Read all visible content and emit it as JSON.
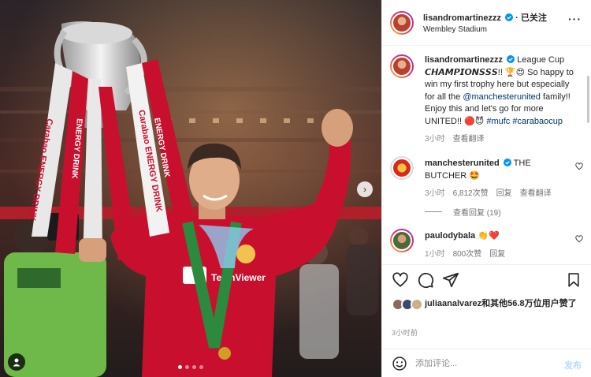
{
  "post": {
    "author": "lisandromartinezzz",
    "location": "Wembley Stadium",
    "follow_status": "· 已关注",
    "more_icon": "more-horizontal-icon"
  },
  "caption": {
    "username": "lisandromartinezzz",
    "text_1": "League Cup",
    "text_bold": "𝘾𝙃𝘼𝙈𝙋𝙄𝙊𝙉𝙎𝙎𝙎",
    "text_2": "!! 🏆😍 So happy to win my first trophy here but especially for all the",
    "mention": "@manchesterunited",
    "text_3": "family!! Enjoy this and let's go for more UNITED!! 🔴😈",
    "hashtag_1": "#mufc",
    "hashtag_2": "#carabaocup",
    "time": "3小时",
    "translate": "查看翻译"
  },
  "comments": [
    {
      "username": "manchesterunited",
      "text": "THE BUTCHER 🤩",
      "time": "3小时",
      "likes": "6,812次赞",
      "reply": "回复",
      "translate": "查看翻译",
      "view_replies": "查看回复 (19)"
    },
    {
      "username": "paulodybala",
      "text": "👏❤️",
      "time": "1小时",
      "likes": "800次赞",
      "reply": "回复"
    }
  ],
  "actions": {
    "like_icon": "heart-icon",
    "comment_icon": "comment-icon",
    "share_icon": "share-icon",
    "save_icon": "bookmark-icon"
  },
  "likes": {
    "user": "juliaanalvarez",
    "rest": "和其他56.8万位用户赞了"
  },
  "timestamp": "3小时前",
  "composer": {
    "placeholder": "添加评论...",
    "post_label": "发布"
  },
  "colors": {
    "verified": "#0095f6",
    "mention": "#00376b",
    "post_disabled": "#b3dbff",
    "jersey": "#c8102e"
  },
  "carousel": {
    "count": 4,
    "active_index": 0
  }
}
